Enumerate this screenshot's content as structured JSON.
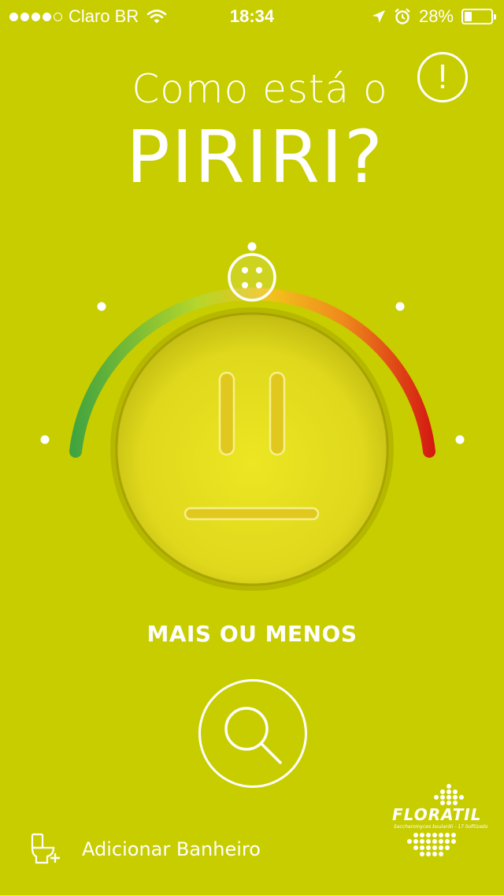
{
  "status_bar": {
    "carrier": "Claro BR",
    "time": "18:34",
    "battery": "28%",
    "battery_level": 0.28,
    "signal_bars": 4,
    "icons": [
      "wifi-icon",
      "location-arrow-icon",
      "alarm-clock-icon",
      "battery-icon"
    ]
  },
  "header": {
    "title_line1": "Como está o",
    "title_line2": "PIRIRI?",
    "info_label": "!"
  },
  "gauge": {
    "scale_colors": [
      "#3fa340",
      "#b6d62b",
      "#f2c21c",
      "#ef8a1c",
      "#d41a12"
    ],
    "face_color": "#e6e41e"
  },
  "mood": {
    "label": "MAIS OU MENOS"
  },
  "actions": {
    "search_icon": "magnifier-icon",
    "add_bathroom_label": "Adicionar Banheiro",
    "add_bathroom_icon": "toilet-add-icon"
  },
  "brand": {
    "name": "FLORATIL",
    "subtitle": "Saccharomyces boulardii - 17 liofilizado"
  },
  "colors": {
    "background": "#c8cd00",
    "text": "#ffffff"
  }
}
